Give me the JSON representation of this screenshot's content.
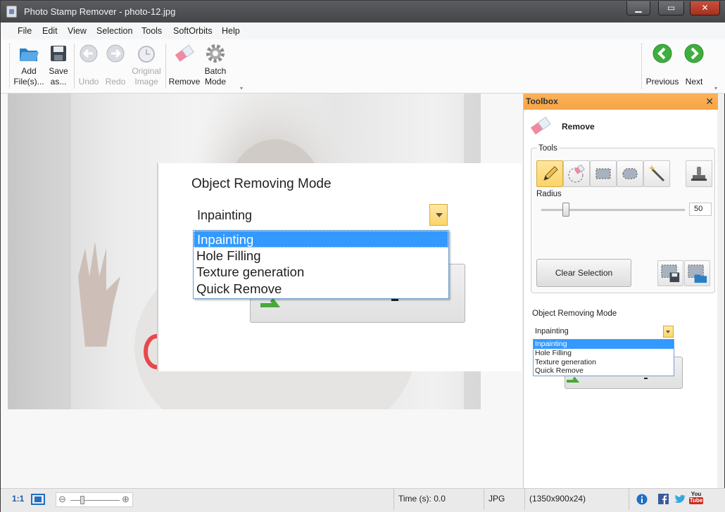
{
  "window": {
    "title": "Photo Stamp Remover - photo-12.jpg",
    "minimize_glyph": "▁",
    "maximize_glyph": "▭",
    "close_glyph": "✕"
  },
  "menu": [
    "File",
    "Edit",
    "View",
    "Selection",
    "Tools",
    "SoftOrbits",
    "Help"
  ],
  "ribbon": {
    "add_files": [
      "Add",
      "File(s)..."
    ],
    "save_as": [
      "Save",
      "as..."
    ],
    "undo": "Undo",
    "redo": "Redo",
    "original_image": [
      "Original",
      "Image"
    ],
    "remove": "Remove",
    "batch_mode": [
      "Batch",
      "Mode"
    ],
    "previous": "Previous",
    "next": "Next"
  },
  "zoom_view": {
    "title": "Object Removing Mode",
    "selected": "Inpainting",
    "options": [
      "Inpainting",
      "Hole Filling",
      "Texture generation",
      "Quick Remove"
    ]
  },
  "toolbox": {
    "title": "Toolbox",
    "close": "✕",
    "section_title": "Remove",
    "tools_label": "Tools",
    "radius_label": "Radius",
    "radius_value": "50",
    "radius_fraction": 0.17,
    "clear_selection": "Clear Selection",
    "mode_label": "Object Removing Mode",
    "mode_selected": "Inpainting",
    "mode_options": [
      "Inpainting",
      "Hole Filling",
      "Texture generation",
      "Quick Remove"
    ]
  },
  "status": {
    "ratio": "1:1",
    "time": "Time (s): 0.0",
    "format": "JPG",
    "dimensions": "(1350x900x24)",
    "youtube_top": "You",
    "youtube_bottom": "Tube"
  },
  "colors": {
    "accent_orange": "#f7a446",
    "selection_blue": "#3399ff",
    "nav_green": "#3fae3f",
    "red_mark": "#e8474d"
  }
}
